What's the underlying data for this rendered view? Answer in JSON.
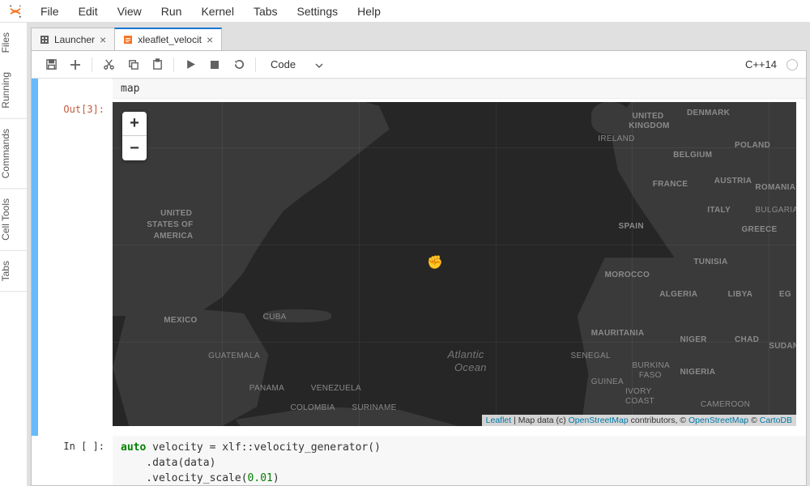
{
  "menu": {
    "items": [
      "File",
      "Edit",
      "View",
      "Run",
      "Kernel",
      "Tabs",
      "Settings",
      "Help"
    ]
  },
  "left_tabs": [
    "Files",
    "Running",
    "Commands",
    "Cell Tools",
    "Tabs"
  ],
  "doc_tabs": [
    {
      "label": "Launcher",
      "active": false
    },
    {
      "label": "xleaflet_velocit",
      "active": true
    }
  ],
  "toolbar": {
    "celltype": "Code",
    "kernel": "C++14"
  },
  "cell_code_top": "map",
  "out_prompt": "Out[3]:",
  "in_prompt": "In [ ]:",
  "map": {
    "zoom_in": "+",
    "zoom_out": "−",
    "attribution": {
      "leaflet": "Leaflet",
      "mid1": " | Map data (c) ",
      "osm1": "OpenStreetMap",
      "mid2": " contributors, © ",
      "osm2": "OpenStreetMap",
      "mid3": " © ",
      "carto": "CartoDB"
    },
    "labels": {
      "usa1": "UNITED",
      "usa2": "STATES OF",
      "usa3": "AMERICA",
      "mexico": "MEXICO",
      "cuba": "CUBA",
      "guatemala": "GUATEMALA",
      "panama": "PANAMA",
      "venezuela": "VENEZUELA",
      "colombia": "COLOMBIA",
      "suriname": "SURINAME",
      "atlantic1": "Atlantic",
      "atlantic2": "Ocean",
      "uk1": "UNITED",
      "uk2": "KINGDOM",
      "ireland": "IRELAND",
      "denmark": "DENMARK",
      "belgium": "BELGIUM",
      "poland": "POLAND",
      "france": "FRANCE",
      "austria": "AUSTRIA",
      "romania": "ROMANIA",
      "spain": "SPAIN",
      "italy": "ITALY",
      "bulgaria": "BULGARIA",
      "greece": "GREECE",
      "morocco": "MOROCCO",
      "tunisia": "TUNISIA",
      "algeria": "ALGERIA",
      "libya": "LIBYA",
      "eg": "EG",
      "mauritania": "MAURITANIA",
      "niger": "NIGER",
      "chad": "CHAD",
      "sudan": "SUDAN",
      "senegal": "SENEGAL",
      "burkina": "BURKINA",
      "faso": "FASO",
      "nigeria": "NIGERIA",
      "guinea": "GUINEA",
      "ivory1": "IVORY",
      "ivory2": "COAST",
      "cameroon": "CAMEROON"
    }
  },
  "code2": {
    "l1a": "auto",
    "l1b": " velocity = xlf::velocity_generator()",
    "l2": "    .data(data)",
    "l3a": "    .velocity_scale(",
    "l3n": "0.01",
    "l3b": ")"
  }
}
